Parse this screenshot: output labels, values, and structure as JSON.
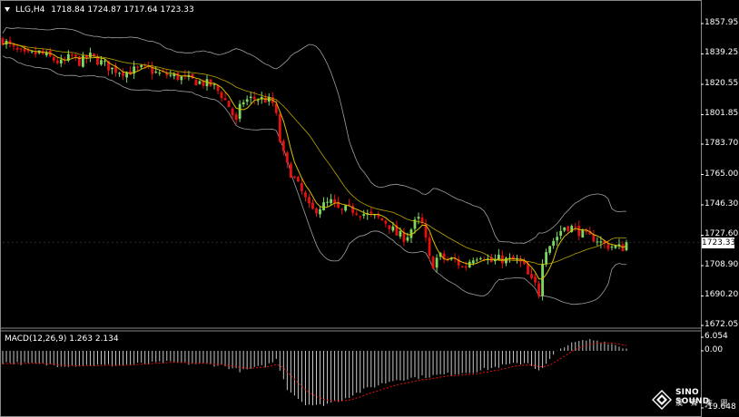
{
  "header": {
    "symbol": "LLG,H4",
    "ohlc": "1718.84 1724.87 1717.64 1723.33"
  },
  "price_axis": [
    "1857.95",
    "1839.25",
    "1820.55",
    "1801.85",
    "1783.70",
    "1765.00",
    "1746.30",
    "1727.60",
    "1708.90",
    "1690.20",
    "1672.05"
  ],
  "current_price": "1723.33",
  "macd": {
    "label": "MACD(12,26,9) 1.263 2.134",
    "axis": [
      "6.054",
      "0.00",
      "-19.648"
    ]
  },
  "watermark": {
    "line1": "SINO SOUND",
    "line2": "漢 聲 集 團"
  },
  "colors": {
    "background": "#000000",
    "bull": "#7dd860",
    "bear": "#e81010",
    "bollinger": "#a0a0a0",
    "ma": "#d8c000",
    "signal": "#e81010",
    "histogram": "#c8c8c8"
  },
  "chart_data": [
    {
      "type": "candlestick",
      "title": "LLG,H4",
      "ylim": [
        1672.05,
        1857.95
      ],
      "anchors": [
        [
          0,
          1848
        ],
        [
          12,
          1842
        ],
        [
          25,
          1838
        ],
        [
          40,
          1840
        ],
        [
          55,
          1836
        ],
        [
          65,
          1833
        ],
        [
          75,
          1838
        ],
        [
          85,
          1834
        ],
        [
          95,
          1838
        ],
        [
          105,
          1835
        ],
        [
          120,
          1830
        ],
        [
          135,
          1828
        ],
        [
          150,
          1830
        ],
        [
          160,
          1830
        ],
        [
          170,
          1827
        ],
        [
          185,
          1826
        ],
        [
          200,
          1824
        ],
        [
          215,
          1822
        ],
        [
          230,
          1820
        ],
        [
          240,
          1814
        ],
        [
          248,
          1807
        ],
        [
          256,
          1797
        ],
        [
          262,
          1810
        ],
        [
          275,
          1812
        ],
        [
          290,
          1811
        ],
        [
          298,
          1808
        ],
        [
          305,
          1782
        ],
        [
          312,
          1770
        ],
        [
          322,
          1760
        ],
        [
          330,
          1752
        ],
        [
          338,
          1742
        ],
        [
          348,
          1745
        ],
        [
          360,
          1748
        ],
        [
          370,
          1742
        ],
        [
          380,
          1744
        ],
        [
          390,
          1742
        ],
        [
          400,
          1740
        ],
        [
          412,
          1738
        ],
        [
          422,
          1735
        ],
        [
          432,
          1728
        ],
        [
          442,
          1726
        ],
        [
          452,
          1735
        ],
        [
          458,
          1738
        ],
        [
          462,
          1730
        ],
        [
          466,
          1718
        ],
        [
          470,
          1708
        ],
        [
          478,
          1715
        ],
        [
          488,
          1712
        ],
        [
          497,
          1712
        ],
        [
          505,
          1707
        ],
        [
          515,
          1714
        ],
        [
          525,
          1716
        ],
        [
          535,
          1711
        ],
        [
          545,
          1713
        ],
        [
          555,
          1712
        ],
        [
          565,
          1712
        ],
        [
          572,
          1708
        ],
        [
          578,
          1700
        ],
        [
          584,
          1697
        ],
        [
          588,
          1692
        ],
        [
          593,
          1718
        ],
        [
          600,
          1722
        ],
        [
          608,
          1727
        ],
        [
          615,
          1733
        ],
        [
          622,
          1733
        ],
        [
          632,
          1730
        ],
        [
          642,
          1726
        ],
        [
          650,
          1726
        ],
        [
          658,
          1722
        ],
        [
          666,
          1721
        ],
        [
          674,
          1720
        ],
        [
          680,
          1720
        ],
        [
          684,
          1723
        ]
      ]
    },
    {
      "type": "macd",
      "title": "MACD(12,26,9)",
      "ylim": [
        -19.648,
        6.054
      ],
      "anchors": [
        [
          0,
          -4
        ],
        [
          60,
          -5
        ],
        [
          120,
          -5
        ],
        [
          180,
          -4
        ],
        [
          240,
          -5
        ],
        [
          262,
          -7
        ],
        [
          290,
          -5
        ],
        [
          300,
          -3
        ],
        [
          312,
          -13
        ],
        [
          330,
          -18
        ],
        [
          345,
          -19
        ],
        [
          370,
          -17
        ],
        [
          400,
          -13
        ],
        [
          430,
          -10
        ],
        [
          460,
          -9
        ],
        [
          490,
          -8
        ],
        [
          520,
          -7
        ],
        [
          550,
          -5
        ],
        [
          575,
          -4
        ],
        [
          590,
          -7
        ],
        [
          600,
          -3
        ],
        [
          615,
          2
        ],
        [
          630,
          4
        ],
        [
          645,
          5
        ],
        [
          660,
          4
        ],
        [
          684,
          1
        ]
      ]
    }
  ]
}
